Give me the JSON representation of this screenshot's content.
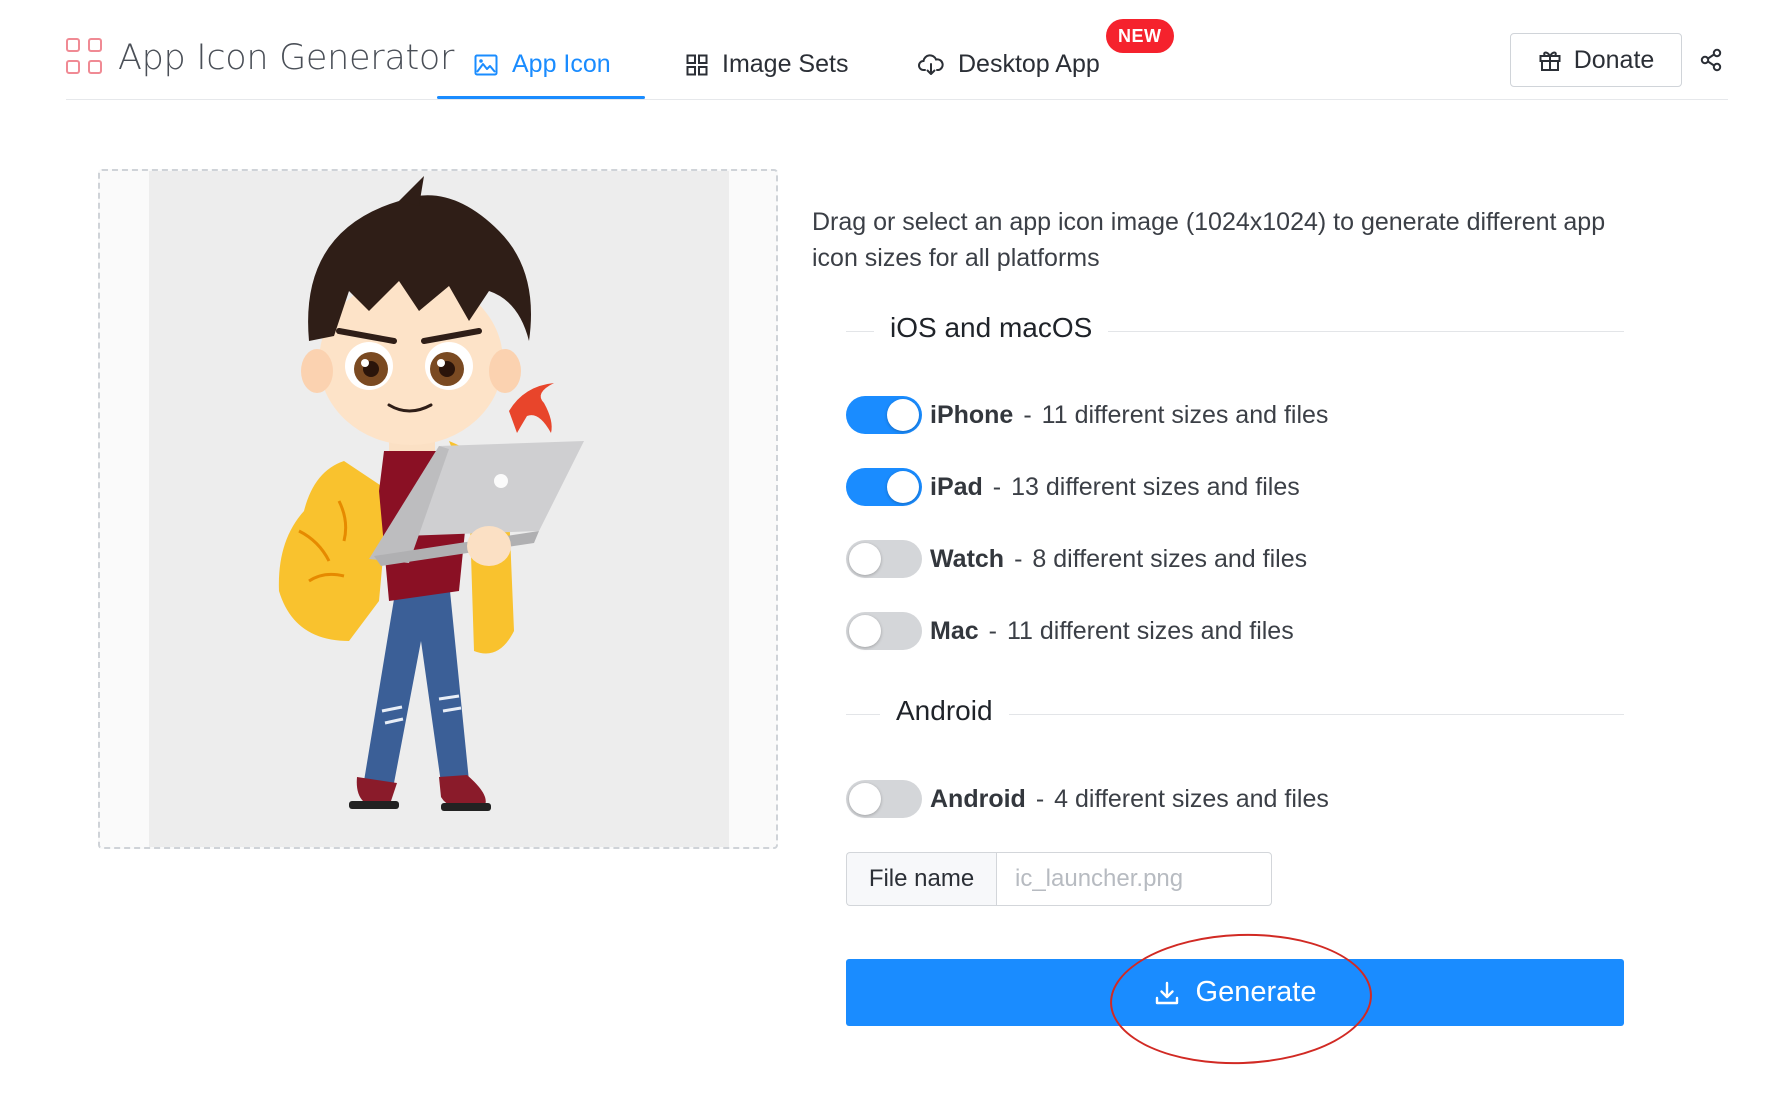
{
  "header": {
    "app_title": "App Icon Generator",
    "logo_icon": "grid-logo-icon",
    "tabs": [
      {
        "label": "App Icon",
        "icon": "image-icon",
        "active": true
      },
      {
        "label": "Image Sets",
        "icon": "grid-icon",
        "active": false
      },
      {
        "label": "Desktop App",
        "icon": "cloud-download-icon",
        "active": false,
        "badge": "NEW"
      }
    ],
    "donate_label": "Donate",
    "donate_icon": "gift-icon",
    "share_icon": "share-icon"
  },
  "upload": {
    "description": "Drag or select an app icon image (1024x1024) to generate different app icon sizes for all platforms",
    "preview_alt": "cartoon character holding a laptop"
  },
  "sections": {
    "ios_title": "iOS and macOS",
    "android_title": "Android"
  },
  "options": {
    "iphone": {
      "name": "iPhone",
      "detail": "11 different sizes and files",
      "enabled": true
    },
    "ipad": {
      "name": "iPad",
      "detail": "13 different sizes and files",
      "enabled": true
    },
    "watch": {
      "name": "Watch",
      "detail": "8 different sizes and files",
      "enabled": false
    },
    "mac": {
      "name": "Mac",
      "detail": "11 different sizes and files",
      "enabled": false
    },
    "android": {
      "name": "Android",
      "detail": "4 different sizes and files",
      "enabled": false
    }
  },
  "file_name": {
    "label": "File name",
    "placeholder": "ic_launcher.png",
    "value": ""
  },
  "generate": {
    "label": "Generate",
    "icon": "download-icon"
  },
  "colors": {
    "accent": "#1a8cff",
    "badge": "#f5222d",
    "annotation": "#d12a24"
  }
}
